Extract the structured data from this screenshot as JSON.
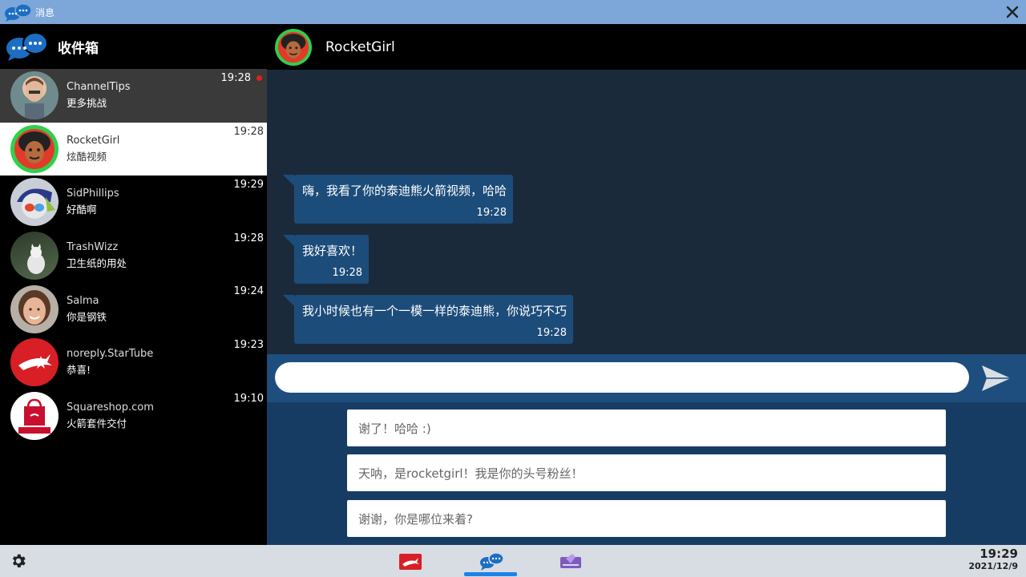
{
  "window": {
    "title": "消息",
    "close_icon": "close-icon"
  },
  "sidebar": {
    "title": "收件箱",
    "conversations": [
      {
        "name": "ChannelTips",
        "preview": "更多挑战",
        "time": "19:28",
        "unread": true
      },
      {
        "name": "RocketGirl",
        "preview": "炫酷视频",
        "time": "19:28",
        "selected": true
      },
      {
        "name": "SidPhillips",
        "preview": "好酷啊",
        "time": "19:29"
      },
      {
        "name": "TrashWizz",
        "preview": "卫生纸的用处",
        "time": "19:28"
      },
      {
        "name": "Salma",
        "preview": "你是钢铁",
        "time": "19:24"
      },
      {
        "name": "noreply.StarTube",
        "preview": "恭喜!",
        "time": "19:23"
      },
      {
        "name": "Squareshop.com",
        "preview": "火箭套件交付",
        "time": "19:10"
      }
    ]
  },
  "chat": {
    "contact": "RocketGirl",
    "messages": [
      {
        "text": "嗨，我看了你的泰迪熊火箭视频，哈哈",
        "time": "19:28"
      },
      {
        "text": "我好喜欢！",
        "time": "19:28"
      },
      {
        "text": "我小时候也有一个一模一样的泰迪熊，你说巧不巧",
        "time": "19:28"
      }
    ],
    "input_value": ""
  },
  "replies": [
    "谢了！哈哈 :)",
    "天呐，是rocketgirl！我是你的头号粉丝！",
    "谢谢，你是哪位来着?"
  ],
  "taskbar": {
    "time": "19:29",
    "date": "2021/12/9"
  },
  "colors": {
    "titlebar": "#7da6d9",
    "bubble": "#1c4c7a",
    "accent": "#1f82e6",
    "unread_dot": "#e0201c"
  }
}
